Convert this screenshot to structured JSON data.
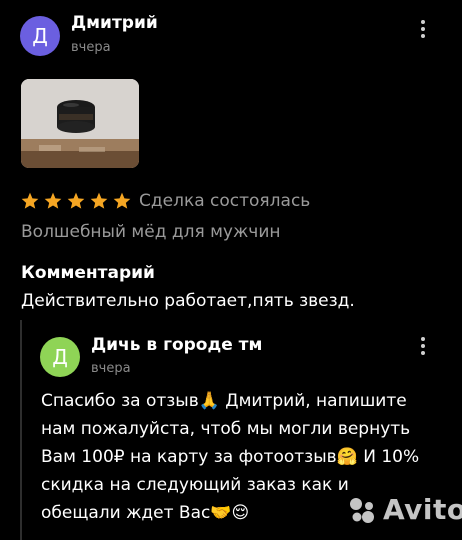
{
  "review": {
    "author": {
      "avatar_letter": "Д",
      "name": "Дмитрий",
      "date": "вчера",
      "avatar_color": "#6b5fe0"
    },
    "rating": 5,
    "deal_status": "Сделка состоялась",
    "product": "Волшебный мёд для мужчин",
    "comment_title": "Комментарий",
    "comment": "Действительно работает,пять звезд."
  },
  "reply": {
    "author": {
      "avatar_letter": "Д",
      "name": "Дичь в городе тм",
      "date": "вчера",
      "avatar_color": "#8fd456"
    },
    "lines": [
      "Спасибо за отзыв🙏 Дмитрий, напишите",
      "нам пожалуйста, чтоб мы могли вернуть",
      "Вам 100₽ на карту за фотоотзыв🤗 И 10%",
      "скидка на следующий заказ как и",
      "обещали ждет Вас🤝😌"
    ]
  },
  "icons": {
    "star": "star-icon",
    "more": "more-vertical-icon"
  },
  "watermark": {
    "text": "Avito"
  },
  "colors": {
    "star": "#f5a623",
    "secondary_text": "#9a9a9a"
  }
}
